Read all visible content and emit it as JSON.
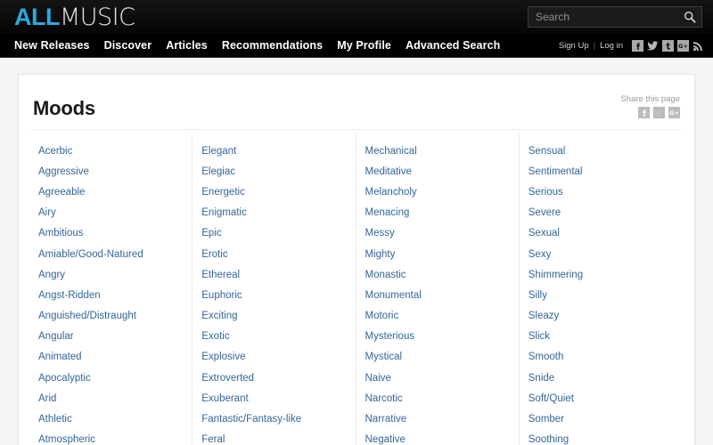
{
  "header": {
    "logo": {
      "part1": "ALL",
      "part2": "MUSIC"
    },
    "search": {
      "placeholder": "Search",
      "value": "",
      "icon": "search-icon"
    }
  },
  "nav": {
    "items": [
      {
        "label": "New Releases"
      },
      {
        "label": "Discover"
      },
      {
        "label": "Articles"
      },
      {
        "label": "Recommendations"
      },
      {
        "label": "My Profile"
      },
      {
        "label": "Advanced Search"
      }
    ],
    "account": {
      "sign_up": "Sign Up",
      "separator": "|",
      "log_in": "Log in"
    },
    "social": [
      {
        "name": "facebook-icon",
        "glyph": "f"
      },
      {
        "name": "twitter-icon",
        "glyph": "t"
      },
      {
        "name": "tumblr-icon",
        "glyph": "t"
      },
      {
        "name": "google-plus-icon",
        "glyph": "G+"
      },
      {
        "name": "rss-icon",
        "glyph": "rss"
      }
    ]
  },
  "main": {
    "title": "Moods",
    "share": {
      "label": "Share this page",
      "icons": [
        {
          "name": "facebook-icon",
          "glyph": "f"
        },
        {
          "name": "twitter-icon",
          "glyph": "t"
        },
        {
          "name": "google-plus-icon",
          "glyph": "G+"
        }
      ]
    },
    "link_color": "#336699",
    "columns": [
      {
        "items": [
          "Acerbic",
          "Aggressive",
          "Agreeable",
          "Airy",
          "Ambitious",
          "Amiable/Good-Natured",
          "Angry",
          "Angst-Ridden",
          "Anguished/Distraught",
          "Angular",
          "Animated",
          "Apocalyptic",
          "Arid",
          "Athletic",
          "Atmospheric"
        ]
      },
      {
        "items": [
          "Elegant",
          "Elegiac",
          "Energetic",
          "Enigmatic",
          "Epic",
          "Erotic",
          "Ethereal",
          "Euphoric",
          "Exciting",
          "Exotic",
          "Explosive",
          "Extroverted",
          "Exuberant",
          "Fantastic/Fantasy-like",
          "Feral"
        ]
      },
      {
        "items": [
          "Mechanical",
          "Meditative",
          "Melancholy",
          "Menacing",
          "Messy",
          "Mighty",
          "Monastic",
          "Monumental",
          "Motoric",
          "Mysterious",
          "Mystical",
          "Naive",
          "Narcotic",
          "Narrative",
          "Negative"
        ]
      },
      {
        "items": [
          "Sensual",
          "Sentimental",
          "Serious",
          "Severe",
          "Sexual",
          "Sexy",
          "Shimmering",
          "Silly",
          "Sleazy",
          "Slick",
          "Smooth",
          "Snide",
          "Soft/Quiet",
          "Somber",
          "Soothing"
        ]
      }
    ]
  }
}
